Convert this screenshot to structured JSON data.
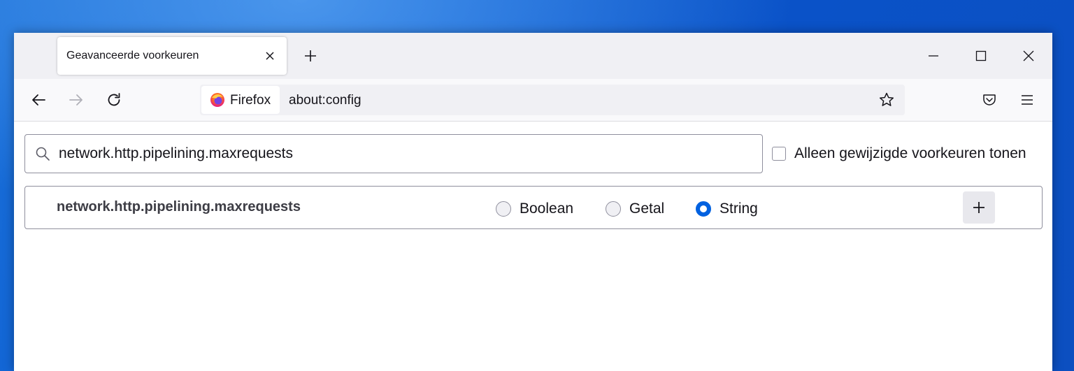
{
  "colors": {
    "desktop_blue": "#0d5fd3",
    "tabstrip_bg": "#f0f0f4",
    "accent": "#0061e0",
    "text": "#15141a"
  },
  "tab": {
    "title": "Geavanceerde voorkeuren",
    "close_icon": "close-icon"
  },
  "window_controls": {
    "minimize_icon": "minimize-icon",
    "maximize_icon": "maximize-icon",
    "close_icon": "close-icon"
  },
  "navbar": {
    "back_icon": "arrow-left-icon",
    "forward_icon": "arrow-right-icon",
    "reload_icon": "reload-icon",
    "identity_label": "Firefox",
    "url": "about:config",
    "bookmark_icon": "star-icon",
    "pocket_icon": "pocket-icon",
    "menu_icon": "hamburger-menu-icon"
  },
  "search": {
    "value": "network.http.pipelining.maxrequests",
    "placeholder": ""
  },
  "filter": {
    "only_modified_label": "Alleen gewijzigde voorkeuren tonen",
    "checked": false
  },
  "new_pref": {
    "name": "network.http.pipelining.maxrequests",
    "types": [
      {
        "label": "Boolean",
        "selected": false
      },
      {
        "label": "Getal",
        "selected": false
      },
      {
        "label": "String",
        "selected": true
      }
    ],
    "add_icon": "plus-icon"
  }
}
